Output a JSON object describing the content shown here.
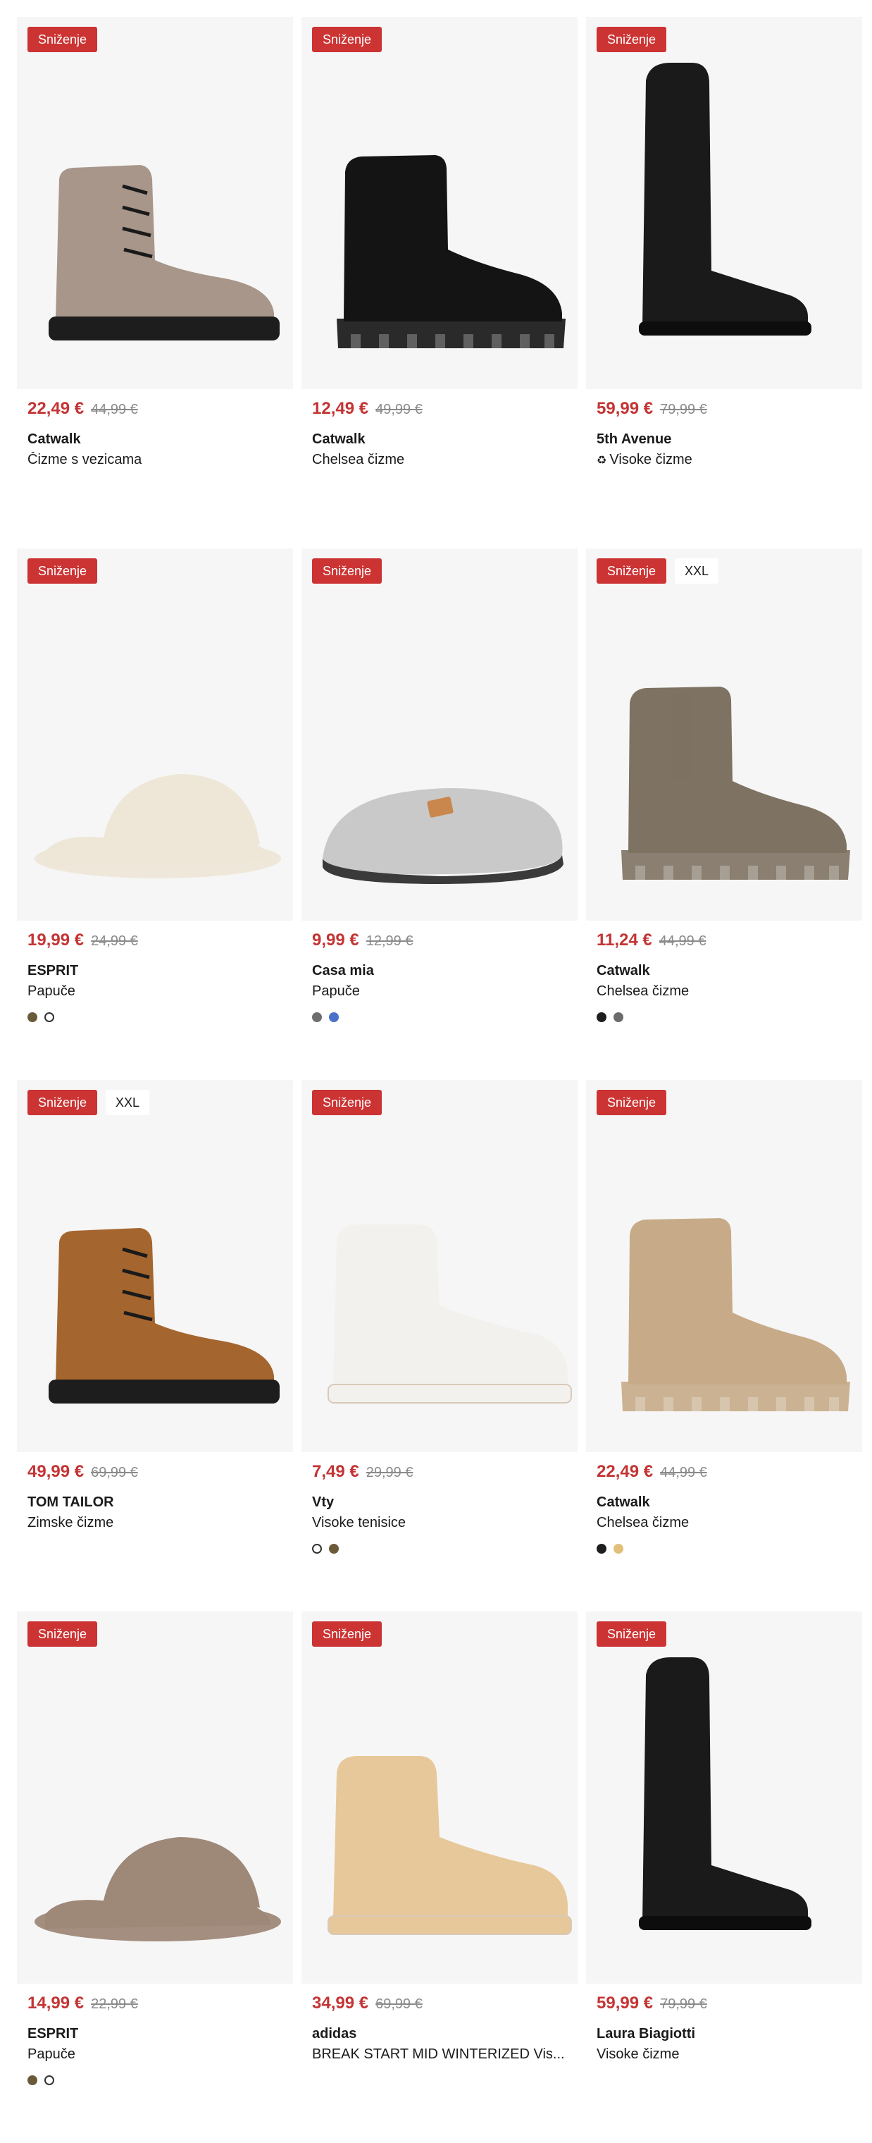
{
  "products": [
    {
      "badges": [
        "Sniženje"
      ],
      "price": "22,49 €",
      "old_price": "44,99 €",
      "brand": "Catwalk",
      "name": "Čizme s vezicama",
      "swatches": []
    },
    {
      "badges": [
        "Sniženje"
      ],
      "price": "12,49 €",
      "old_price": "49,99 €",
      "brand": "Catwalk",
      "name": "Chelsea čizme",
      "swatches": []
    },
    {
      "badges": [
        "Sniženje"
      ],
      "price": "59,99 €",
      "old_price": "79,99 €",
      "brand": "5th Avenue",
      "name": "Visoke čizme",
      "name_icon": "sustainability-icon",
      "swatches": []
    },
    {
      "badges": [
        "Sniženje"
      ],
      "price": "19,99 €",
      "old_price": "24,99 €",
      "brand": "ESPRIT",
      "name": "Papuče",
      "swatches": [
        "#6b5a3a",
        "#ffffff"
      ]
    },
    {
      "badges": [
        "Sniženje"
      ],
      "price": "9,99 €",
      "old_price": "12,99 €",
      "brand": "Casa mia",
      "name": "Papuče",
      "swatches": [
        "#6e6e6e",
        "#4a72c8"
      ]
    },
    {
      "badges": [
        "Sniženje",
        "XXL"
      ],
      "price": "11,24 €",
      "old_price": "44,99 €",
      "brand": "Catwalk",
      "name": "Chelsea čizme",
      "swatches": [
        "#1e1e1e",
        "#6b6b6b"
      ]
    },
    {
      "badges": [
        "Sniženje",
        "XXL"
      ],
      "price": "49,99 €",
      "old_price": "69,99 €",
      "brand": "TOM TAILOR",
      "name": "Zimske čizme",
      "swatches": []
    },
    {
      "badges": [
        "Sniženje"
      ],
      "price": "7,49 €",
      "old_price": "29,99 €",
      "brand": "Vty",
      "name": "Visoke tenisice",
      "swatches": [
        "#ffffff",
        "#6b5a3a"
      ]
    },
    {
      "badges": [
        "Sniženje"
      ],
      "price": "22,49 €",
      "old_price": "44,99 €",
      "brand": "Catwalk",
      "name": "Chelsea čizme",
      "swatches": [
        "#1e1e1e",
        "#e2c07a"
      ]
    },
    {
      "badges": [
        "Sniženje"
      ],
      "price": "14,99 €",
      "old_price": "22,99 €",
      "brand": "ESPRIT",
      "name": "Papuče",
      "swatches": [
        "#6b5a3a",
        "#ffffff"
      ]
    },
    {
      "badges": [
        "Sniženje"
      ],
      "price": "34,99 €",
      "old_price": "69,99 €",
      "brand": "adidas",
      "name": "BREAK START MID WINTERIZED Vis...",
      "swatches": []
    },
    {
      "badges": [
        "Sniženje"
      ],
      "price": "59,99 €",
      "old_price": "79,99 €",
      "brand": "Laura Biagiotti",
      "name": "Visoke čizme",
      "swatches": []
    }
  ],
  "shoe_images": [
    {
      "icon": "lace-up-boot-icon",
      "color": "#a8968a"
    },
    {
      "icon": "chelsea-boot-icon",
      "color": "#141414"
    },
    {
      "icon": "tall-boot-icon",
      "color": "#1a1a1a"
    },
    {
      "icon": "fur-slipper-icon",
      "color": "#eee7d8"
    },
    {
      "icon": "felt-slipper-icon",
      "color": "#c9c9c9"
    },
    {
      "icon": "chelsea-boot-icon",
      "color": "#7e7262"
    },
    {
      "icon": "lace-up-boot-icon",
      "color": "#a5652e"
    },
    {
      "icon": "high-top-sneaker-icon",
      "color": "#f3f1ee"
    },
    {
      "icon": "chelsea-boot-icon",
      "color": "#c7ab88"
    },
    {
      "icon": "fur-slipper-icon",
      "color": "#9e8878"
    },
    {
      "icon": "high-top-sneaker-icon",
      "color": "#e7c89a"
    },
    {
      "icon": "tall-boot-icon",
      "color": "#1a1a1a"
    }
  ]
}
